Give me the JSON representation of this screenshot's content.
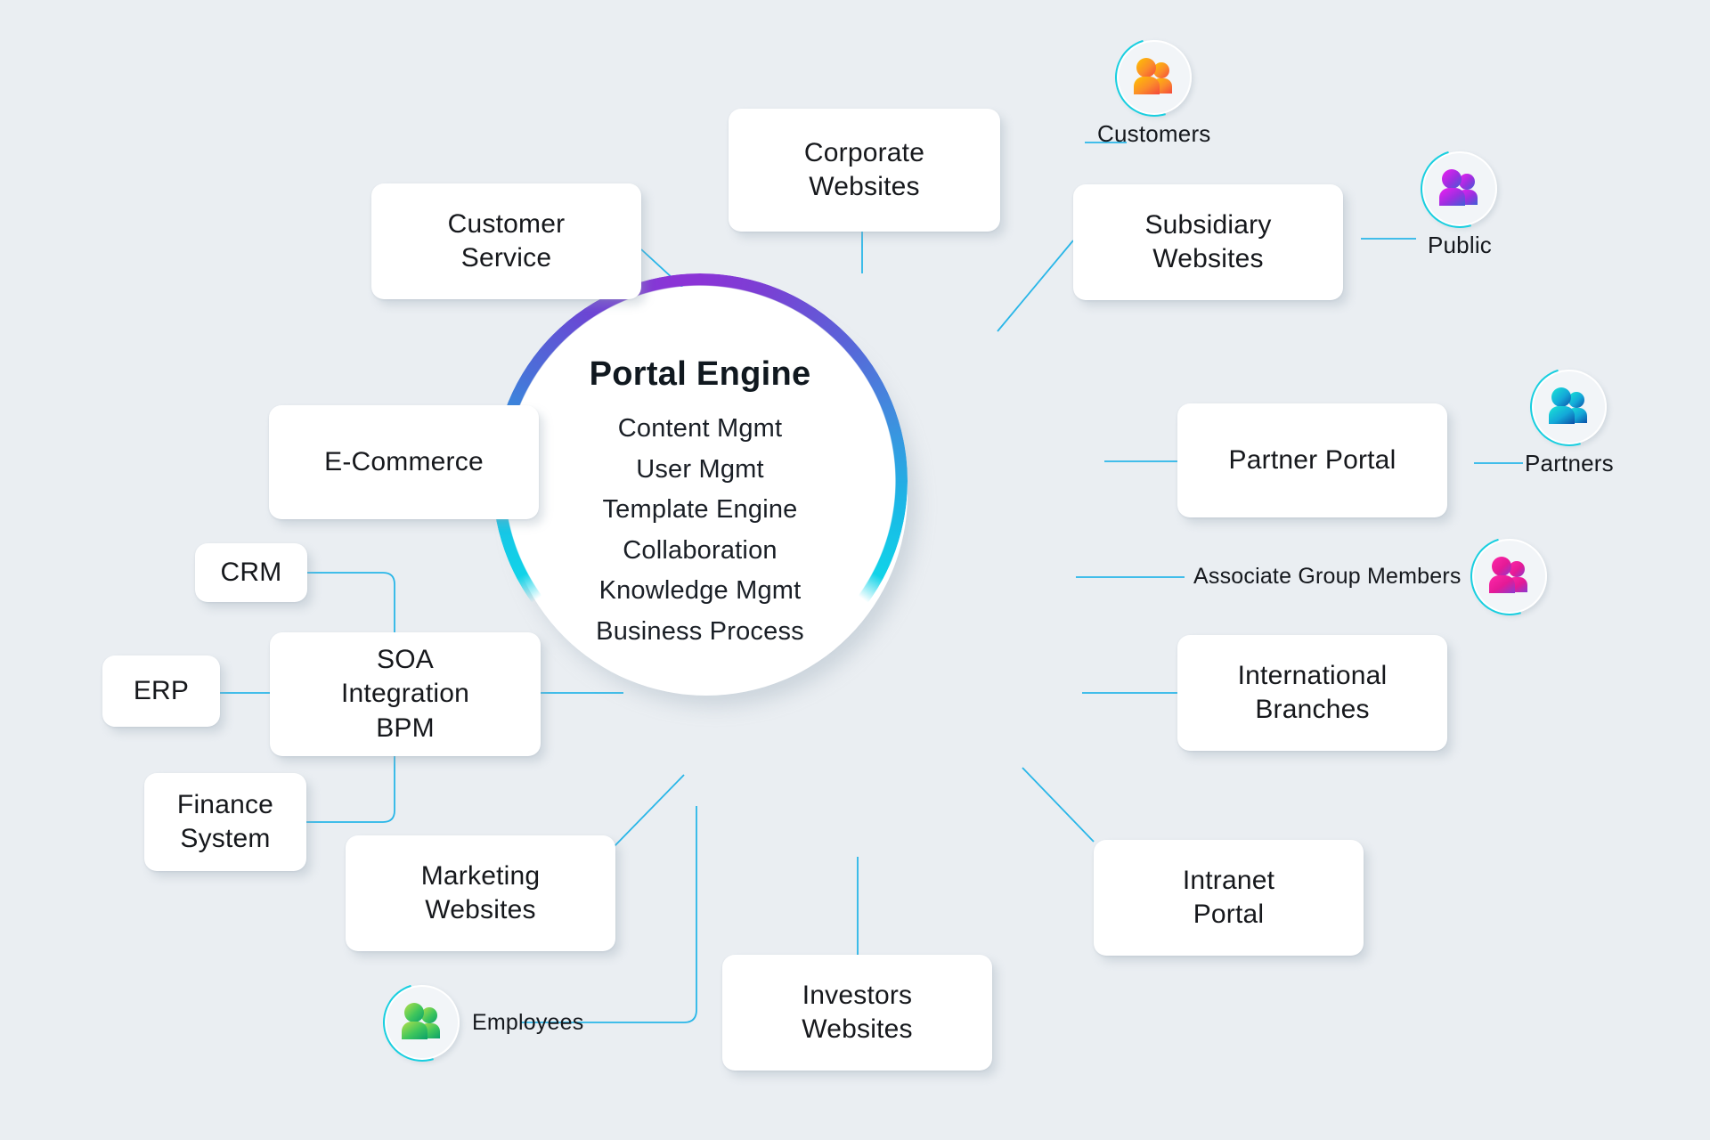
{
  "page": {
    "background_color": "#eaeef2",
    "line_color": "#29b6e8"
  },
  "hub": {
    "title": "Portal Engine",
    "features": [
      "Content Mgmt",
      "User Mgmt",
      "Template Engine",
      "Collaboration",
      "Knowledge Mgmt",
      "Business Process"
    ],
    "ring_gradient": [
      "#8b34d6",
      "#5a63d8",
      "#19b9e6",
      "#11d3e8"
    ]
  },
  "nodes": [
    {
      "id": "corporate-websites",
      "label": "Corporate\nWebsites"
    },
    {
      "id": "customer-service",
      "label": "Customer\nService"
    },
    {
      "id": "subsidiary-websites",
      "label": "Subsidiary\nWebsites"
    },
    {
      "id": "e-commerce",
      "label": "E-Commerce"
    },
    {
      "id": "partner-portal",
      "label": "Partner Portal"
    },
    {
      "id": "crm",
      "label": "CRM"
    },
    {
      "id": "soa-integration-bpm",
      "label": "SOA\nIntegration\nBPM"
    },
    {
      "id": "erp",
      "label": "ERP"
    },
    {
      "id": "finance-system",
      "label": "Finance\nSystem"
    },
    {
      "id": "international-branches",
      "label": "International\nBranches"
    },
    {
      "id": "marketing-websites",
      "label": "Marketing\nWebsites"
    },
    {
      "id": "intranet-portal",
      "label": "Intranet\nPortal"
    },
    {
      "id": "investors-websites",
      "label": "Investors\nWebsites"
    }
  ],
  "audiences": [
    {
      "id": "customers",
      "label": "Customers",
      "icon": "people-icon",
      "color": "#f9a21b"
    },
    {
      "id": "public",
      "label": "Public",
      "icon": "people-icon",
      "color": "#c628e0"
    },
    {
      "id": "partners",
      "label": "Partners",
      "icon": "people-icon",
      "color": "#1ad3d3"
    },
    {
      "id": "associate-group-members",
      "label": "Associate Group Members",
      "icon": "people-icon",
      "color": "#f4249a"
    },
    {
      "id": "employees",
      "label": "Employees",
      "icon": "people-icon",
      "color": "#7fd13b"
    }
  ]
}
